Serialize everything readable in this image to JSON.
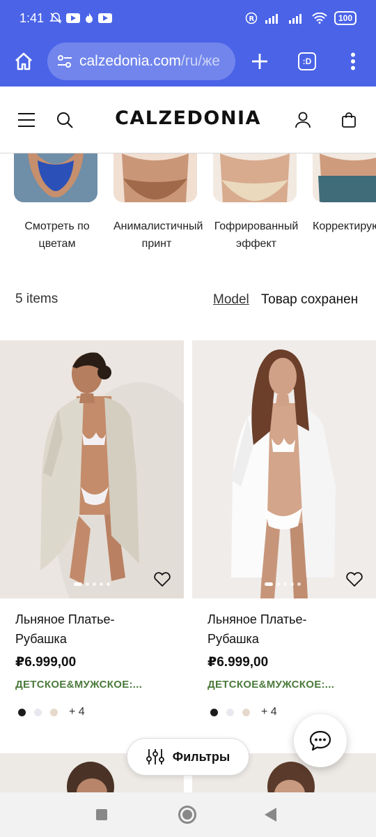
{
  "status_bar": {
    "time": "1:41",
    "battery": "100"
  },
  "browser": {
    "url_domain": "calzedonia.com",
    "url_path": "/ru/же",
    "tabs_label": ":D"
  },
  "site": {
    "logo": "CALZEDONIA"
  },
  "categories": [
    {
      "label": "Смотреть по цветам",
      "color": "#2b50b8"
    },
    {
      "label": "Анималистичный принт",
      "color": "#a06a4a"
    },
    {
      "label": "Гофрированный эффект",
      "color": "#ead9bd"
    },
    {
      "label": "Корректирующие",
      "color": "#3f6c78"
    }
  ],
  "listing": {
    "items_count": "5 items",
    "model_link": "Model",
    "saved_text": "Товар сохранен"
  },
  "products": [
    {
      "name": "Льняное Платье-Рубашка",
      "price": "₽6.999,00",
      "promo": "ДЕТСКОЕ&МУЖСКОЕ:...",
      "more_colors": "+ 4",
      "swatches": [
        "#1c1c1c",
        "#e9e8f0",
        "#e6d9cc"
      ],
      "shirt_color": "#ddd8cc"
    },
    {
      "name": "Льняное Платье-Рубашка",
      "price": "₽6.999,00",
      "promo": "ДЕТСКОЕ&МУЖСКОЕ:...",
      "more_colors": "+ 4",
      "swatches": [
        "#1c1c1c",
        "#e9e8f0",
        "#e6d9cc"
      ],
      "shirt_color": "#fbfbfb"
    }
  ],
  "filters": {
    "label": "Фильтры"
  },
  "colors": {
    "browser_blue": "#4a63e7",
    "promo_green": "#4b7a3c"
  }
}
